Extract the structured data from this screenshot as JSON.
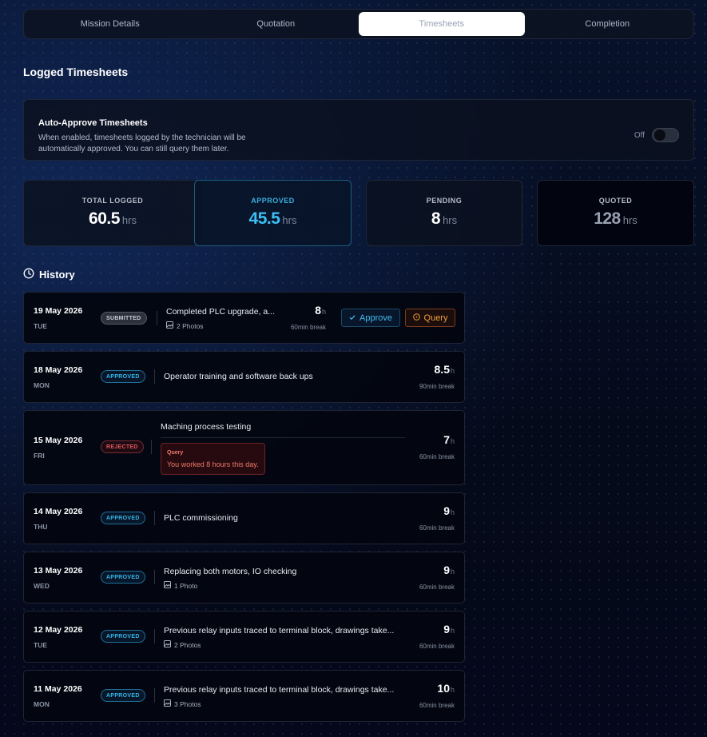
{
  "tabs": [
    {
      "label": "Mission Details"
    },
    {
      "label": "Quotation"
    },
    {
      "label": "Timesheets"
    },
    {
      "label": "Completion"
    }
  ],
  "page_title": "Logged Timesheets",
  "auto_approve": {
    "title": "Auto-Approve Timesheets",
    "description": "When enabled, timesheets logged by the technician will be automatically approved. You can still query them later.",
    "toggle_label": "Off",
    "enabled": false
  },
  "stats": [
    {
      "label": "TOTAL LOGGED",
      "value": "60.5",
      "unit": "hrs"
    },
    {
      "label": "APPROVED",
      "value": "45.5",
      "unit": "hrs"
    },
    {
      "label": "PENDING",
      "value": "8",
      "unit": "hrs"
    },
    {
      "label": "QUOTED",
      "value": "128",
      "unit": "hrs"
    }
  ],
  "history": {
    "title": "History",
    "entries": [
      {
        "date": "19 May 2026",
        "day": "TUE",
        "status": "SUBMITTED",
        "description": "Completed PLC upgrade, a...",
        "photos": "2 Photos",
        "hours": "8",
        "unit": "h",
        "break": "60min break",
        "approve_label": "Approve",
        "query_label": "Query"
      },
      {
        "date": "18 May 2026",
        "day": "MON",
        "status": "APPROVED",
        "description": "Operator training and software back ups",
        "hours": "8.5",
        "unit": "h",
        "break": "90min break"
      },
      {
        "date": "15 May 2026",
        "day": "FRI",
        "status": "REJECTED",
        "description": "Maching process testing",
        "query_title": "Query",
        "query_message": "You worked 8 hours this day.",
        "hours": "7",
        "unit": "h",
        "break": "60min break"
      },
      {
        "date": "14 May 2026",
        "day": "THU",
        "status": "APPROVED",
        "description": "PLC commissioning",
        "hours": "9",
        "unit": "h",
        "break": "60min break"
      },
      {
        "date": "13 May 2026",
        "day": "WED",
        "status": "APPROVED",
        "description": "Replacing both motors, IO checking",
        "photos": "1 Photo",
        "hours": "9",
        "unit": "h",
        "break": "60min break"
      },
      {
        "date": "12 May 2026",
        "day": "TUE",
        "status": "APPROVED",
        "description": "Previous relay inputs traced to terminal block, drawings take...",
        "photos": "2 Photos",
        "hours": "9",
        "unit": "h",
        "break": "60min break"
      },
      {
        "date": "11 May 2026",
        "day": "MON",
        "status": "APPROVED",
        "description": "Previous relay inputs traced to terminal block, drawings take...",
        "photos": "3 Photos",
        "hours": "10",
        "unit": "h",
        "break": "60min break"
      }
    ]
  },
  "colors": {
    "accent": "#3cc0f5",
    "approved": "#38b4e6",
    "rejected": "#e0585a",
    "query": "#ef9f3a"
  }
}
